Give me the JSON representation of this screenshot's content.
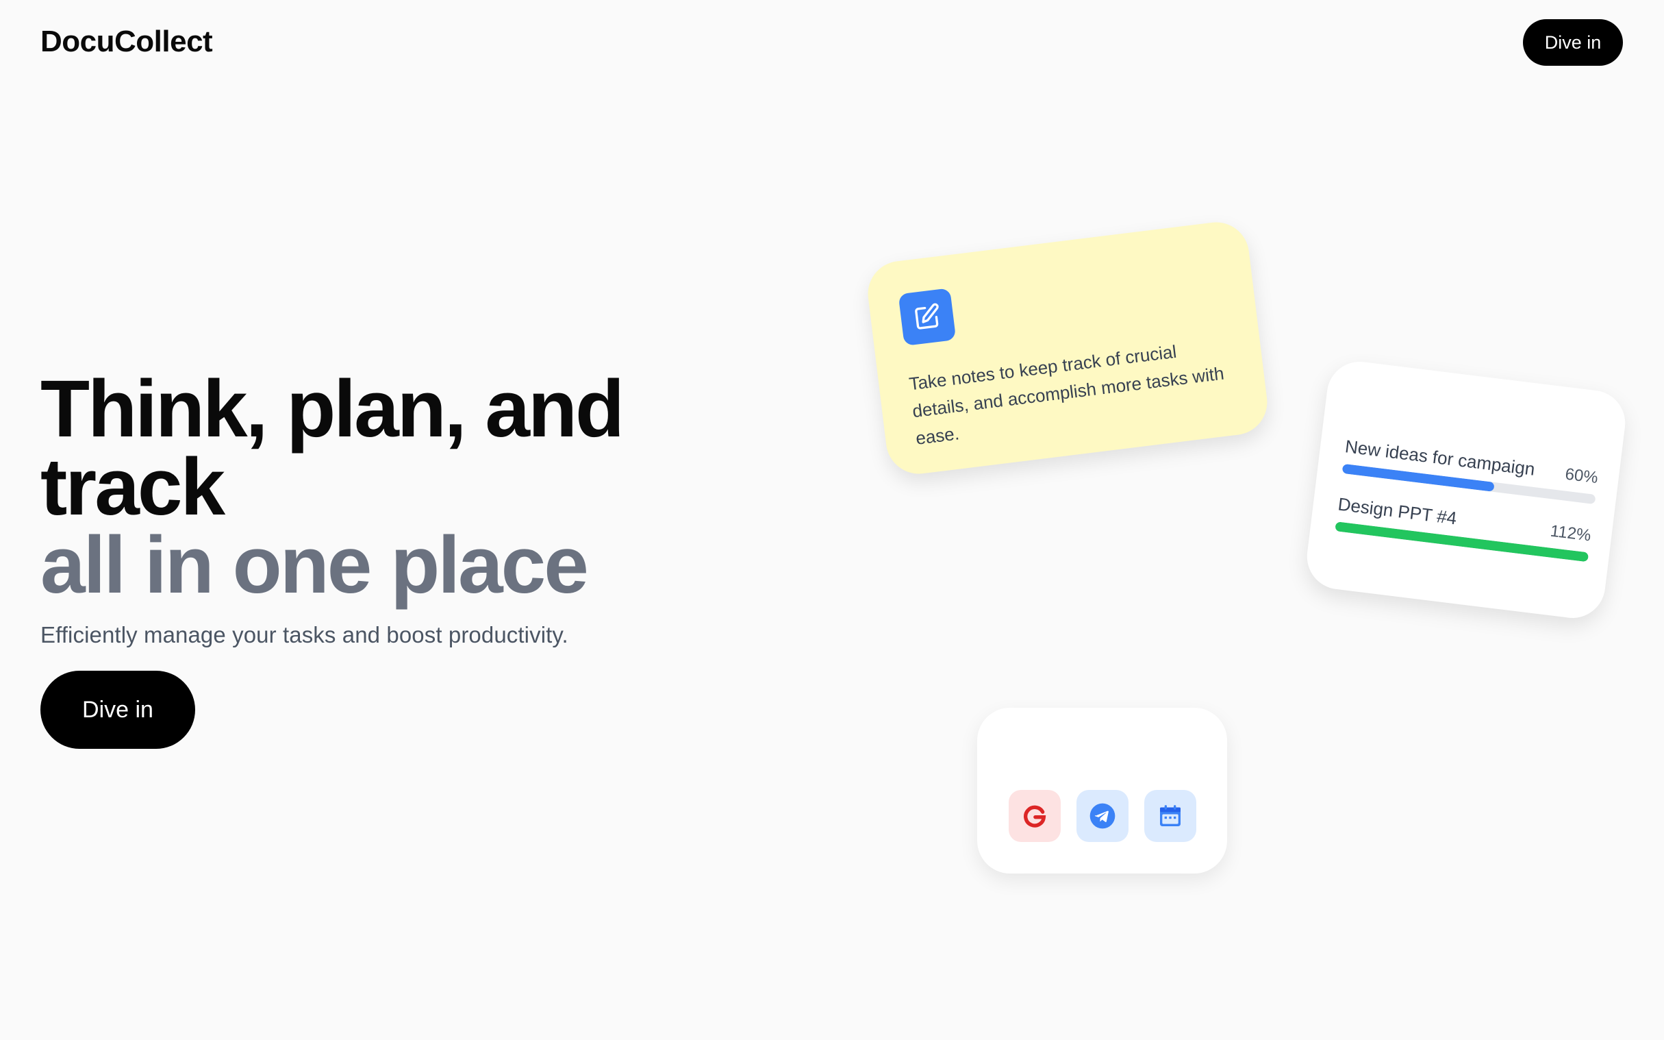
{
  "header": {
    "logo": "DocuCollect",
    "cta_label": "Dive in"
  },
  "hero": {
    "title_line1": "Think, plan, and",
    "title_line2": "track",
    "title_line3": "all in one place",
    "subtitle": "Efficiently manage your tasks and boost productivity.",
    "cta_label": "Dive in"
  },
  "note_card": {
    "icon": "edit-icon",
    "text": "Take notes to keep track of crucial details, and accomplish more tasks with ease.",
    "accent_color": "#3b82f6",
    "background_color": "#fef9c3"
  },
  "progress_card": {
    "items": [
      {
        "label": "New ideas for campaign",
        "percent_label": "60%",
        "fill_fraction": 0.6,
        "color": "#3b82f6"
      },
      {
        "label": "Design PPT #4",
        "percent_label": "112%",
        "fill_fraction": 1.0,
        "color": "#22c55e"
      }
    ]
  },
  "apps_card": {
    "apps": [
      {
        "name": "google-icon",
        "color": "#dc2626"
      },
      {
        "name": "telegram-icon",
        "color": "#3b82f6"
      },
      {
        "name": "calendar-icon",
        "color": "#3b82f6"
      }
    ]
  }
}
